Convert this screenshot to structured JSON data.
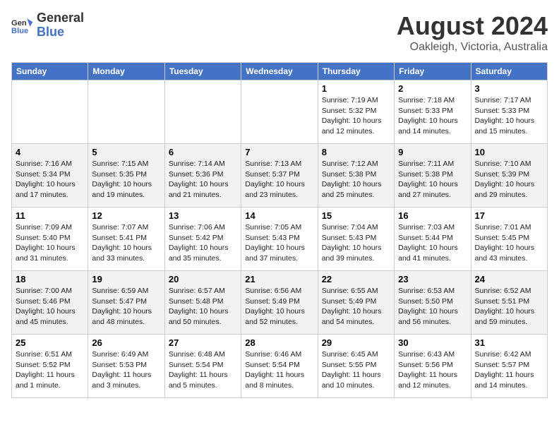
{
  "header": {
    "logo_line1": "General",
    "logo_line2": "Blue",
    "month_year": "August 2024",
    "location": "Oakleigh, Victoria, Australia"
  },
  "weekdays": [
    "Sunday",
    "Monday",
    "Tuesday",
    "Wednesday",
    "Thursday",
    "Friday",
    "Saturday"
  ],
  "weeks": [
    {
      "days": [
        {
          "number": "",
          "info": ""
        },
        {
          "number": "",
          "info": ""
        },
        {
          "number": "",
          "info": ""
        },
        {
          "number": "",
          "info": ""
        },
        {
          "number": "1",
          "info": "Sunrise: 7:19 AM\nSunset: 5:32 PM\nDaylight: 10 hours\nand 12 minutes."
        },
        {
          "number": "2",
          "info": "Sunrise: 7:18 AM\nSunset: 5:33 PM\nDaylight: 10 hours\nand 14 minutes."
        },
        {
          "number": "3",
          "info": "Sunrise: 7:17 AM\nSunset: 5:33 PM\nDaylight: 10 hours\nand 15 minutes."
        }
      ]
    },
    {
      "days": [
        {
          "number": "4",
          "info": "Sunrise: 7:16 AM\nSunset: 5:34 PM\nDaylight: 10 hours\nand 17 minutes."
        },
        {
          "number": "5",
          "info": "Sunrise: 7:15 AM\nSunset: 5:35 PM\nDaylight: 10 hours\nand 19 minutes."
        },
        {
          "number": "6",
          "info": "Sunrise: 7:14 AM\nSunset: 5:36 PM\nDaylight: 10 hours\nand 21 minutes."
        },
        {
          "number": "7",
          "info": "Sunrise: 7:13 AM\nSunset: 5:37 PM\nDaylight: 10 hours\nand 23 minutes."
        },
        {
          "number": "8",
          "info": "Sunrise: 7:12 AM\nSunset: 5:38 PM\nDaylight: 10 hours\nand 25 minutes."
        },
        {
          "number": "9",
          "info": "Sunrise: 7:11 AM\nSunset: 5:38 PM\nDaylight: 10 hours\nand 27 minutes."
        },
        {
          "number": "10",
          "info": "Sunrise: 7:10 AM\nSunset: 5:39 PM\nDaylight: 10 hours\nand 29 minutes."
        }
      ]
    },
    {
      "days": [
        {
          "number": "11",
          "info": "Sunrise: 7:09 AM\nSunset: 5:40 PM\nDaylight: 10 hours\nand 31 minutes."
        },
        {
          "number": "12",
          "info": "Sunrise: 7:07 AM\nSunset: 5:41 PM\nDaylight: 10 hours\nand 33 minutes."
        },
        {
          "number": "13",
          "info": "Sunrise: 7:06 AM\nSunset: 5:42 PM\nDaylight: 10 hours\nand 35 minutes."
        },
        {
          "number": "14",
          "info": "Sunrise: 7:05 AM\nSunset: 5:43 PM\nDaylight: 10 hours\nand 37 minutes."
        },
        {
          "number": "15",
          "info": "Sunrise: 7:04 AM\nSunset: 5:43 PM\nDaylight: 10 hours\nand 39 minutes."
        },
        {
          "number": "16",
          "info": "Sunrise: 7:03 AM\nSunset: 5:44 PM\nDaylight: 10 hours\nand 41 minutes."
        },
        {
          "number": "17",
          "info": "Sunrise: 7:01 AM\nSunset: 5:45 PM\nDaylight: 10 hours\nand 43 minutes."
        }
      ]
    },
    {
      "days": [
        {
          "number": "18",
          "info": "Sunrise: 7:00 AM\nSunset: 5:46 PM\nDaylight: 10 hours\nand 45 minutes."
        },
        {
          "number": "19",
          "info": "Sunrise: 6:59 AM\nSunset: 5:47 PM\nDaylight: 10 hours\nand 48 minutes."
        },
        {
          "number": "20",
          "info": "Sunrise: 6:57 AM\nSunset: 5:48 PM\nDaylight: 10 hours\nand 50 minutes."
        },
        {
          "number": "21",
          "info": "Sunrise: 6:56 AM\nSunset: 5:49 PM\nDaylight: 10 hours\nand 52 minutes."
        },
        {
          "number": "22",
          "info": "Sunrise: 6:55 AM\nSunset: 5:49 PM\nDaylight: 10 hours\nand 54 minutes."
        },
        {
          "number": "23",
          "info": "Sunrise: 6:53 AM\nSunset: 5:50 PM\nDaylight: 10 hours\nand 56 minutes."
        },
        {
          "number": "24",
          "info": "Sunrise: 6:52 AM\nSunset: 5:51 PM\nDaylight: 10 hours\nand 59 minutes."
        }
      ]
    },
    {
      "days": [
        {
          "number": "25",
          "info": "Sunrise: 6:51 AM\nSunset: 5:52 PM\nDaylight: 11 hours\nand 1 minute."
        },
        {
          "number": "26",
          "info": "Sunrise: 6:49 AM\nSunset: 5:53 PM\nDaylight: 11 hours\nand 3 minutes."
        },
        {
          "number": "27",
          "info": "Sunrise: 6:48 AM\nSunset: 5:54 PM\nDaylight: 11 hours\nand 5 minutes."
        },
        {
          "number": "28",
          "info": "Sunrise: 6:46 AM\nSunset: 5:54 PM\nDaylight: 11 hours\nand 8 minutes."
        },
        {
          "number": "29",
          "info": "Sunrise: 6:45 AM\nSunset: 5:55 PM\nDaylight: 11 hours\nand 10 minutes."
        },
        {
          "number": "30",
          "info": "Sunrise: 6:43 AM\nSunset: 5:56 PM\nDaylight: 11 hours\nand 12 minutes."
        },
        {
          "number": "31",
          "info": "Sunrise: 6:42 AM\nSunset: 5:57 PM\nDaylight: 11 hours\nand 14 minutes."
        }
      ]
    }
  ]
}
